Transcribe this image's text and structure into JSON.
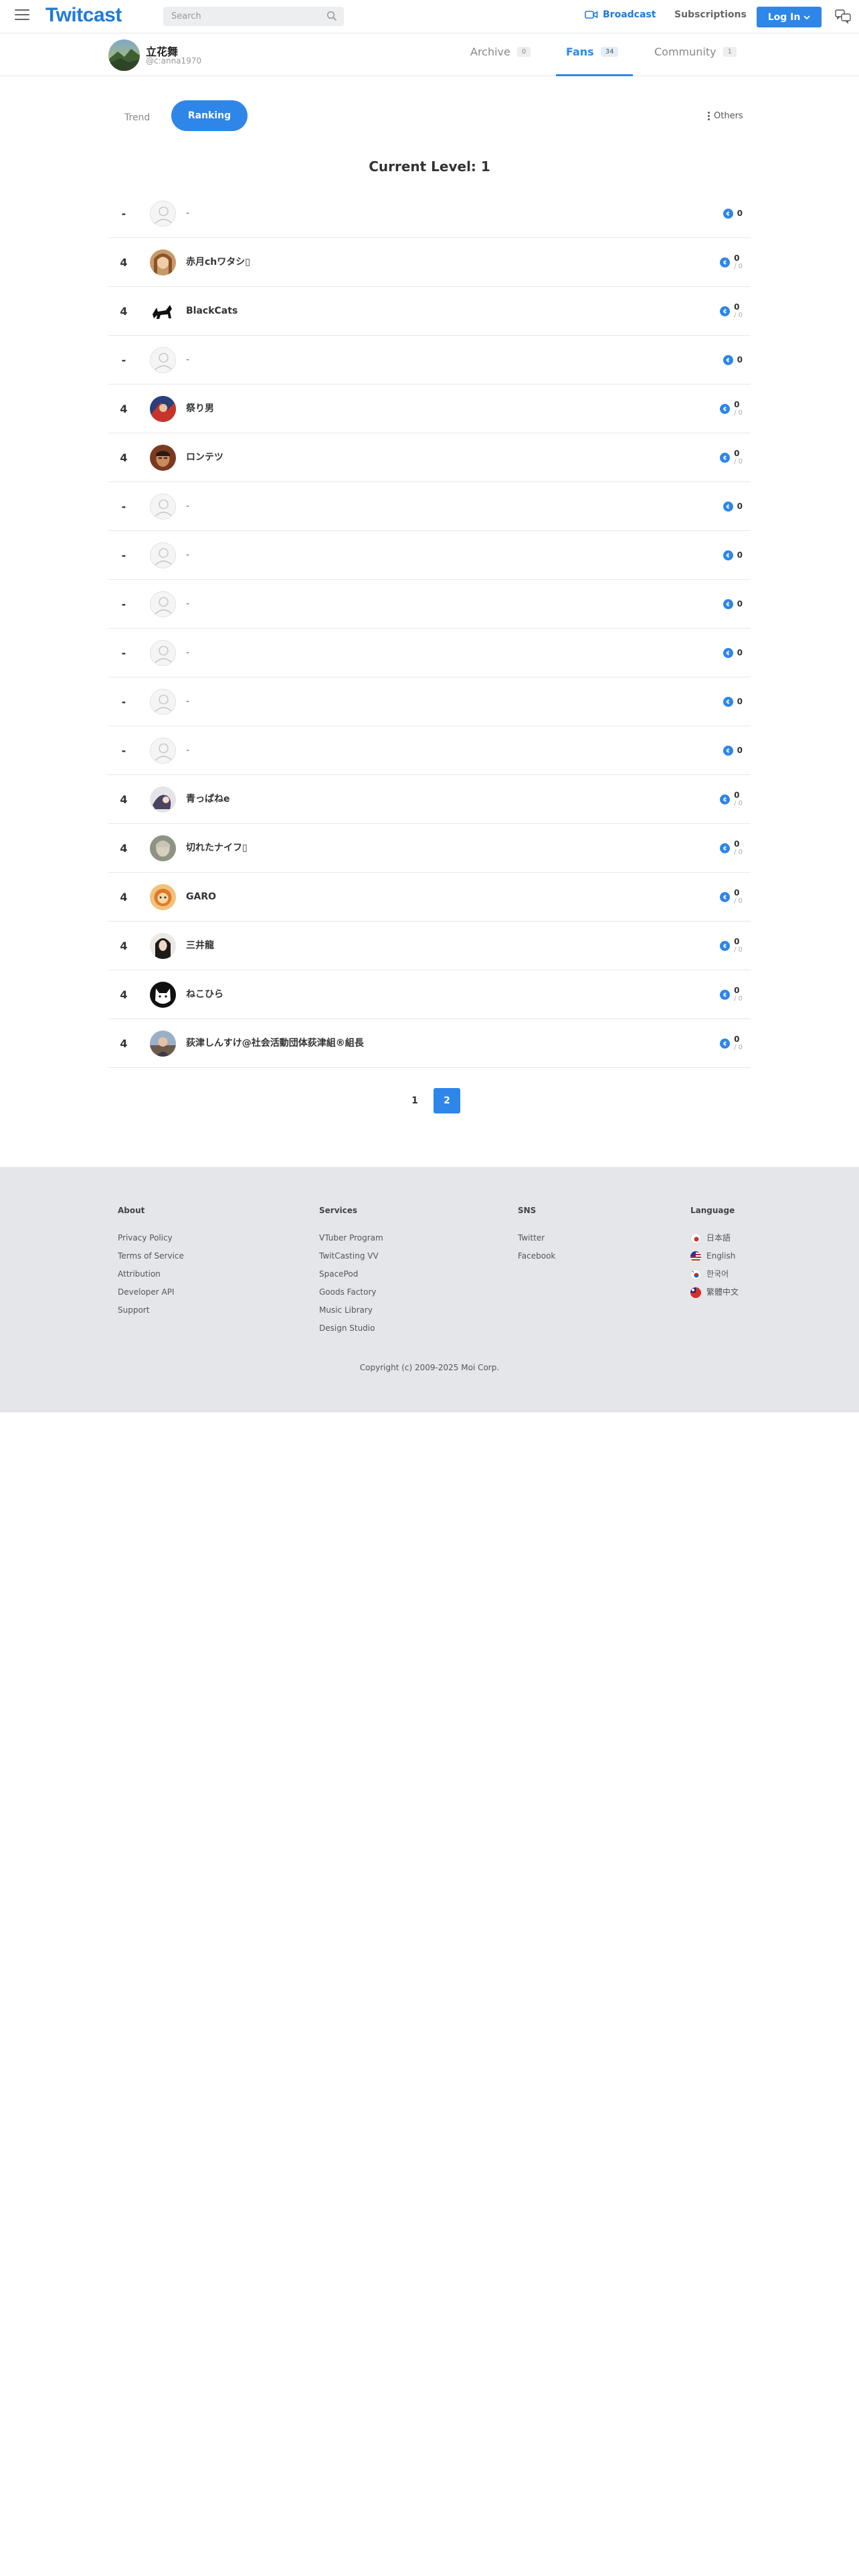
{
  "header": {
    "logo": "Twitcast",
    "search_placeholder": "Search",
    "broadcast_label": "Broadcast",
    "subscriptions_label": "Subscriptions",
    "login_label": "Log In",
    "accent_color": "#2e86e8"
  },
  "profile": {
    "name": "立花舞",
    "id": "@c:anna1970",
    "tabs": [
      {
        "label": "Archive",
        "count": "0"
      },
      {
        "label": "Fans",
        "count": "34"
      },
      {
        "label": "Community",
        "count": "1"
      }
    ],
    "active_tab": "Fans"
  },
  "subtabs": {
    "trend": "Trend",
    "ranking": "Ranking",
    "others": "Others"
  },
  "level_text": "Current Level: 1",
  "rows": [
    {
      "rank": "-",
      "name": "-",
      "score": "0",
      "sub": ""
    },
    {
      "rank": "4",
      "name": "赤月chワタシ▯",
      "score": "0",
      "sub": "/ 0"
    },
    {
      "rank": "4",
      "name": "BlackCats",
      "score": "0",
      "sub": "/ 0"
    },
    {
      "rank": "-",
      "name": "-",
      "score": "0",
      "sub": ""
    },
    {
      "rank": "4",
      "name": "祭り男",
      "score": "0",
      "sub": "/ 0"
    },
    {
      "rank": "4",
      "name": "ロンテツ",
      "score": "0",
      "sub": "/ 0"
    },
    {
      "rank": "-",
      "name": "-",
      "score": "0",
      "sub": ""
    },
    {
      "rank": "-",
      "name": "-",
      "score": "0",
      "sub": ""
    },
    {
      "rank": "-",
      "name": "-",
      "score": "0",
      "sub": ""
    },
    {
      "rank": "-",
      "name": "-",
      "score": "0",
      "sub": ""
    },
    {
      "rank": "-",
      "name": "-",
      "score": "0",
      "sub": ""
    },
    {
      "rank": "-",
      "name": "-",
      "score": "0",
      "sub": ""
    },
    {
      "rank": "4",
      "name": "青っぱねe",
      "score": "0",
      "sub": "/ 0"
    },
    {
      "rank": "4",
      "name": "切れたナイフ▯",
      "score": "0",
      "sub": "/ 0"
    },
    {
      "rank": "4",
      "name": "GARO",
      "score": "0",
      "sub": "/ 0"
    },
    {
      "rank": "4",
      "name": "三井龍",
      "score": "0",
      "sub": "/ 0"
    },
    {
      "rank": "4",
      "name": "ねこひら",
      "score": "0",
      "sub": "/ 0"
    },
    {
      "rank": "4",
      "name": "荻津しんすけ@社会活動団体荻津組®組長",
      "score": "0",
      "sub": "/ 0"
    }
  ],
  "pagination": {
    "pages": [
      "1",
      "2"
    ],
    "current": "2"
  },
  "footer": {
    "about": {
      "title": "About",
      "links": [
        "Privacy Policy",
        "Terms of Service",
        "Attribution",
        "Developer API",
        "Support"
      ]
    },
    "services": {
      "title": "Services",
      "links": [
        "VTuber Program",
        "TwitCasting VV",
        "SpacePod",
        "Goods Factory",
        "Music Library",
        "Design Studio"
      ]
    },
    "sns": {
      "title": "SNS",
      "links": [
        "Twitter",
        "Facebook"
      ]
    },
    "language": {
      "title": "Language",
      "links": [
        "日本語",
        "English",
        "한국어",
        "繁體中文"
      ]
    },
    "copyright": "Copyright (c) 2009-2025 Moi Corp."
  }
}
